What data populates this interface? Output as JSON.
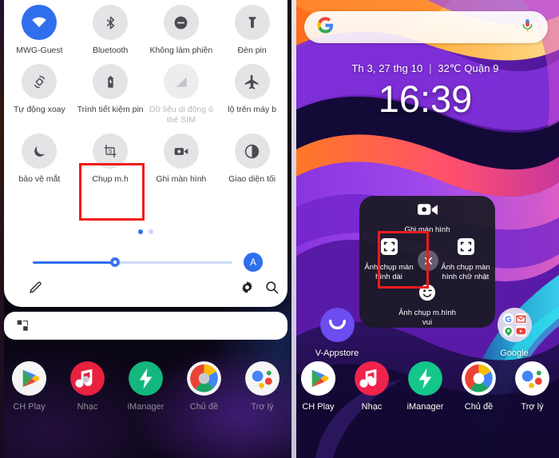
{
  "left_panel": {
    "quick_settings": {
      "tiles": [
        {
          "label": "MWG-Guest",
          "icon": "wifi-icon",
          "state": "on"
        },
        {
          "label": "Bluetooth",
          "icon": "bluetooth-icon",
          "state": "off"
        },
        {
          "label": "Không làm phiền",
          "icon": "do-not-disturb-icon",
          "state": "off"
        },
        {
          "label": "Đèn pin",
          "icon": "flashlight-icon",
          "state": "off"
        },
        {
          "label": "Tự động xoay",
          "icon": "auto-rotate-icon",
          "state": "off"
        },
        {
          "label": "Trình tiết kiệm pin",
          "icon": "battery-saver-icon",
          "state": "off"
        },
        {
          "label": "Dữ liệu di động ó thẻ SIM",
          "icon": "mobile-data-off-icon",
          "state": "disabled"
        },
        {
          "label": "lộ trên máy b",
          "icon": "airplane-mode-icon",
          "state": "off"
        },
        {
          "label": "bảo vệ mắt",
          "icon": "eye-care-moon-icon",
          "state": "off"
        },
        {
          "label": "Chụp m.h",
          "icon": "screenshot-icon",
          "state": "off",
          "highlighted": true
        },
        {
          "label": "Ghi màn hình",
          "icon": "screen-record-icon",
          "state": "off"
        },
        {
          "label": "Giao diện tối",
          "icon": "dark-theme-icon",
          "state": "off"
        }
      ],
      "page_dots": {
        "count": 2,
        "active_index": 0
      },
      "brightness": {
        "value_percent": 41,
        "auto_label": "A",
        "thumb_icon": "brightness-sun-icon"
      },
      "footer": {
        "edit_icon": "pencil-edit-icon",
        "settings_icon": "gear-icon",
        "search_icon": "search-icon"
      }
    },
    "notification_card": {
      "icon": "app-shortcut-icon"
    },
    "dock": [
      {
        "label": "CH Play",
        "icon": "google-play-icon"
      },
      {
        "label": "Nhạc",
        "icon": "music-icon"
      },
      {
        "label": "iManager",
        "icon": "imanager-bolt-icon"
      },
      {
        "label": "Chủ đề",
        "icon": "themes-icon"
      },
      {
        "label": "Trợ lý",
        "icon": "google-assistant-icon"
      }
    ]
  },
  "right_panel": {
    "search_bar": {
      "logo_icon": "google-g-icon",
      "mic_icon": "microphone-icon"
    },
    "clock_widget": {
      "date": "Th 3, 27 thg 10",
      "separator": "|",
      "weather": "32℃  Quận 9",
      "time": "16:39"
    },
    "screenshot_popup": {
      "items": [
        {
          "label": "Ghi màn hình",
          "icon": "video-camera-icon",
          "position": "top"
        },
        {
          "label": "Ảnh chụp màn hình dài",
          "icon": "long-screenshot-icon",
          "position": "left",
          "highlighted": true
        },
        {
          "label": "Ảnh chụp màn hình chữ nhật",
          "icon": "rect-screenshot-icon",
          "position": "right"
        },
        {
          "label": "Ảnh chụp m.hình vui",
          "icon": "fun-smiley-icon",
          "position": "bottom"
        }
      ],
      "close_icon": "close-x-icon"
    },
    "home_apps": [
      {
        "label": "V-Appstore",
        "icon": "v-appstore-icon"
      },
      {
        "label": "Google",
        "icon": "google-folder-icon"
      }
    ],
    "dock": [
      {
        "label": "CH Play",
        "icon": "google-play-icon"
      },
      {
        "label": "Nhạc",
        "icon": "music-icon"
      },
      {
        "label": "iManager",
        "icon": "imanager-bolt-icon"
      },
      {
        "label": "Chủ đề",
        "icon": "themes-icon"
      },
      {
        "label": "Trợ lý",
        "icon": "google-assistant-icon"
      }
    ]
  },
  "colors": {
    "accent_blue": "#2f6fed",
    "highlight_red": "#ef1b1b",
    "tile_bg": "#e4e4e6",
    "shade_bg": "#ffffff",
    "popup_bg": "#1a1a23"
  }
}
